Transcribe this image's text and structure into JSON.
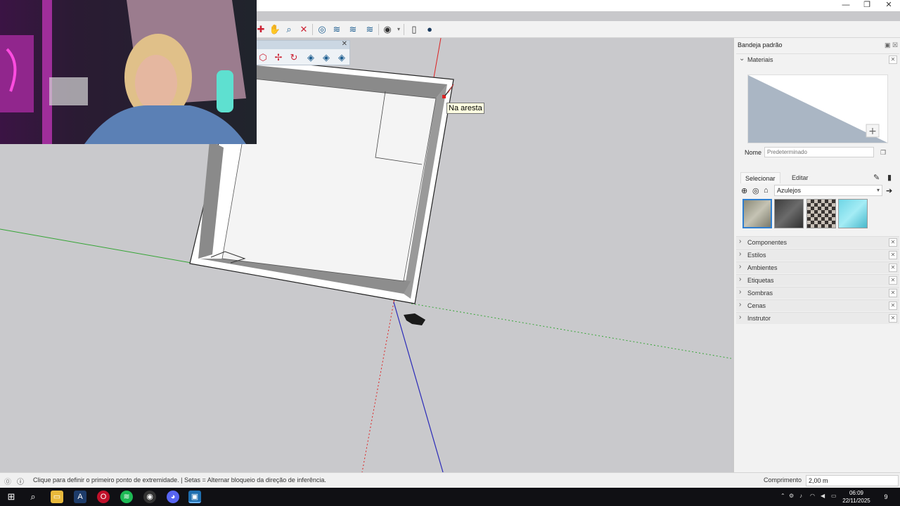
{
  "window": {
    "minimize": "—",
    "restore": "❐",
    "close": "✕"
  },
  "toolbar": {
    "icons": [
      "paint-bucket-icon",
      "orbit-icon",
      "zoom-icon",
      "zoom-extents-icon",
      "sandbox-icon",
      "stamp-icon",
      "drape-icon",
      "flip-icon",
      "account-icon",
      "new-file-icon",
      "user-icon"
    ]
  },
  "palette": {
    "close": "✕"
  },
  "viewport": {
    "tooltip": "Na aresta"
  },
  "tray": {
    "title": "Bandeja padrão",
    "materials": {
      "header": "Materiais",
      "name_label": "Nome",
      "name_placeholder": "Predeterminado",
      "tab_select": "Selecionar",
      "tab_edit": "Editar",
      "library": "Azulejos",
      "swatches": [
        "tile-beige",
        "tile-dark-gray",
        "tile-checker",
        "tile-cyan"
      ]
    },
    "sections": [
      "Componentes",
      "Estilos",
      "Ambientes",
      "Etiquetas",
      "Sombras",
      "Cenas",
      "Instrutor"
    ]
  },
  "status": {
    "text": "Clique para definir o primeiro ponto de extremidade.  |  Setas = Alternar bloqueio da direção de inferência.",
    "measure_label": "Comprimento",
    "measure_value": "2,00 m"
  },
  "taskbar": {
    "time": "06:09",
    "date": "22/11/2025",
    "notifications": "9"
  }
}
